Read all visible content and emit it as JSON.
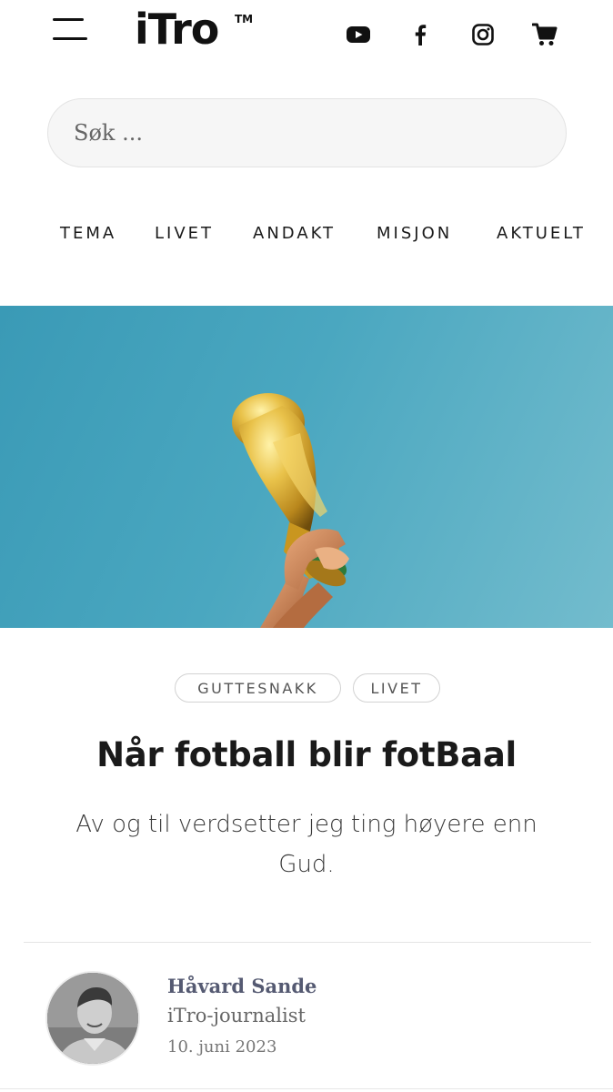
{
  "header": {
    "logo": "iTro",
    "logo_tm": "TM",
    "icons": [
      "menu-icon",
      "youtube-icon",
      "facebook-icon",
      "instagram-icon",
      "cart-icon"
    ]
  },
  "search": {
    "placeholder": "Søk ..."
  },
  "nav": {
    "items": [
      {
        "label": "TEMA"
      },
      {
        "label": "LIVET"
      },
      {
        "label": "ANDAKT"
      },
      {
        "label": "MISJON"
      },
      {
        "label": "AKTUELT"
      }
    ]
  },
  "article": {
    "tags": [
      "GUTTESNAKK",
      "LIVET"
    ],
    "title": "Når fotball blir fotBaal",
    "lead": "Av og til verdsetter jeg ting høyere enn Gud.",
    "author": {
      "name": "Håvard Sande",
      "role": "iTro-journalist",
      "date": "10. juni 2023"
    }
  },
  "colors": {
    "sky": "#4aa7c0",
    "trophy_gold": "#d4a62a",
    "author_name": "#555a72"
  }
}
